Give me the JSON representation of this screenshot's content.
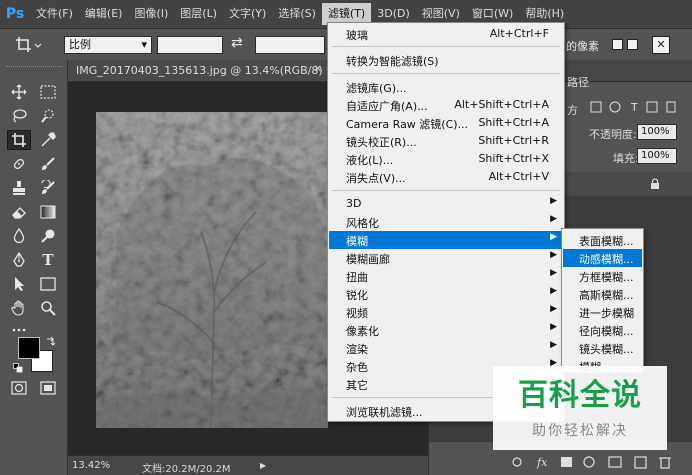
{
  "app": {
    "logo": "Ps"
  },
  "menubar": {
    "items": [
      "文件(F)",
      "编辑(E)",
      "图像(I)",
      "图层(L)",
      "文字(Y)",
      "选择(S)",
      "滤镜(T)",
      "3D(D)",
      "视图(V)",
      "窗口(W)",
      "帮助(H)"
    ],
    "active_index": 6
  },
  "options": {
    "ratio_select": "比例",
    "ratio_arrow": "▾",
    "swap_icon": "⇄",
    "content_aware_label": "的像素",
    "close_icon": "✕"
  },
  "document": {
    "tab_title": "IMG_20170403_135613.jpg @ 13.4%(RGB/8) *",
    "tab_close": "✕",
    "zoom": "13.42%",
    "doc_info": "文档:20.2M/20.2M",
    "status_arrow": "▶"
  },
  "filter_menu": {
    "items": [
      {
        "label": "玻璃",
        "shortcut": "Alt+Ctrl+F"
      },
      {
        "label": "转换为智能滤镜(S)",
        "shortcut": ""
      },
      {
        "label": "滤镜库(G)...",
        "shortcut": ""
      },
      {
        "label": "自适应广角(A)...",
        "shortcut": "Alt+Shift+Ctrl+A"
      },
      {
        "label": "Camera Raw 滤镜(C)...",
        "shortcut": "Shift+Ctrl+A"
      },
      {
        "label": "镜头校正(R)...",
        "shortcut": "Shift+Ctrl+R"
      },
      {
        "label": "液化(L)...",
        "shortcut": "Shift+Ctrl+X"
      },
      {
        "label": "消失点(V)...",
        "shortcut": "Alt+Ctrl+V"
      },
      {
        "label": "3D",
        "submenu": true
      },
      {
        "label": "风格化",
        "submenu": true
      },
      {
        "label": "模糊",
        "submenu": true
      },
      {
        "label": "模糊画廊",
        "submenu": true
      },
      {
        "label": "扭曲",
        "submenu": true
      },
      {
        "label": "锐化",
        "submenu": true
      },
      {
        "label": "视频",
        "submenu": true
      },
      {
        "label": "像素化",
        "submenu": true
      },
      {
        "label": "渲染",
        "submenu": true
      },
      {
        "label": "杂色",
        "submenu": true
      },
      {
        "label": "其它",
        "submenu": true
      },
      {
        "label": "浏览联机滤镜...",
        "shortcut": ""
      }
    ],
    "highlight_index": 10
  },
  "blur_submenu": {
    "items": [
      "表面模糊...",
      "动感模糊...",
      "方框模糊...",
      "高斯模糊...",
      "进一步模糊",
      "径向模糊...",
      "镜头模糊...",
      "模糊"
    ],
    "highlight_index": 1
  },
  "right_panel": {
    "tab_label": "路径",
    "mode_label": "方",
    "opacity_label": "不透明度:",
    "opacity_value": "100%",
    "fill_label": "填充:",
    "fill_value": "100%",
    "lock_icon": "🔒"
  },
  "watermark": {
    "title": "百科全说",
    "subtitle": "助你轻松解决"
  },
  "colors": {
    "menu_highlight": "#0078d7",
    "ps_blue": "#31a8ff",
    "watermark_green": "#16a04a"
  }
}
